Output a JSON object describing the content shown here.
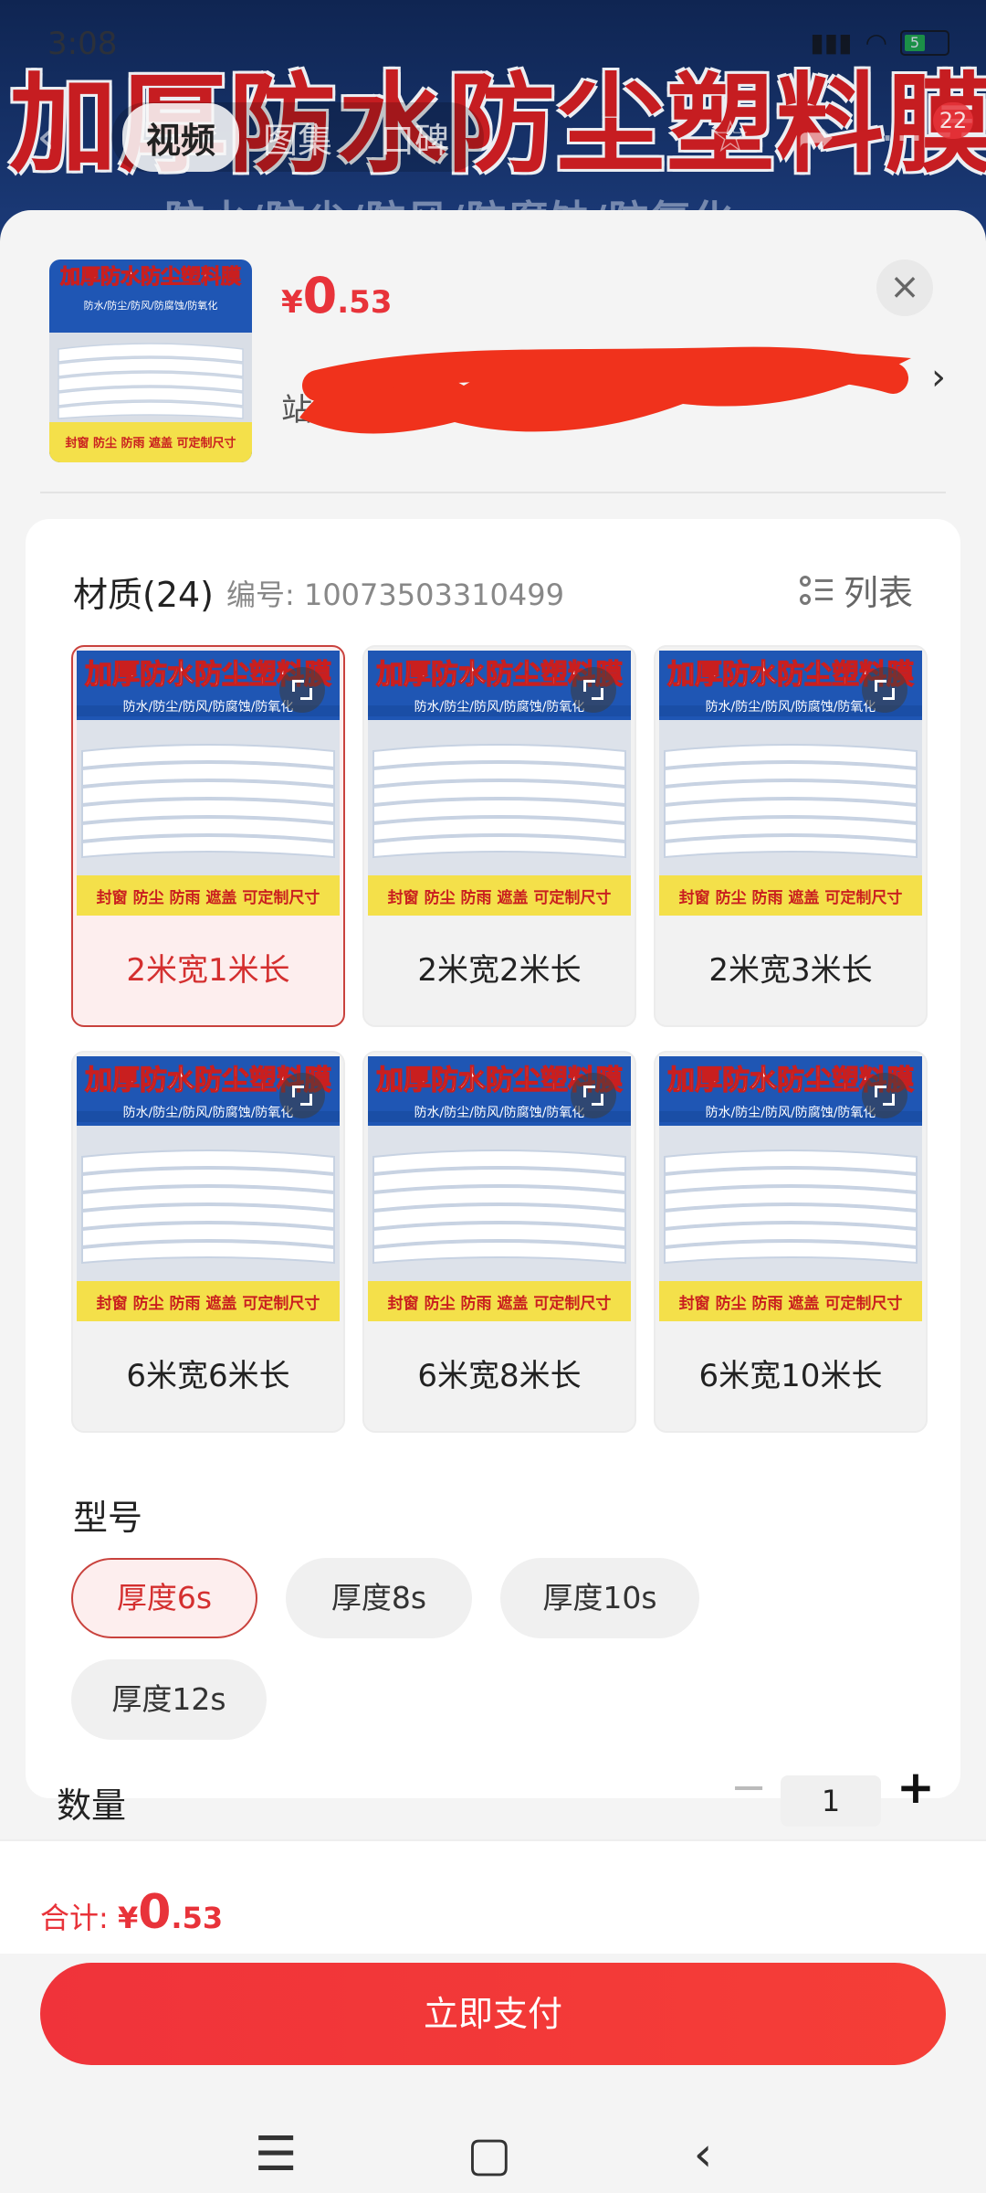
{
  "status_bar": {
    "time": "3:08",
    "battery": "5"
  },
  "banner": {
    "title": "加厚防水防尘塑料膜",
    "subtitle": "防水/防尘/防风/防腐蚀/防氧化"
  },
  "top_nav": {
    "tabs": [
      "视频",
      "图集",
      "口碑"
    ],
    "active_tab": "视频",
    "cart_badge": "22"
  },
  "product": {
    "currency": "¥",
    "price_int": "0",
    "price_dec": ".53",
    "thumb_text": {
      "title": "加厚防水防尘塑料膜",
      "features": "防水/防尘/防风/防腐蚀/防氧化",
      "tags": "封窗 防尘 防雨 遮盖 可定制尺寸"
    },
    "address_partial": "站"
  },
  "material": {
    "title": "材质(24)",
    "code": "编号: 10073503310499",
    "list_label": "列表",
    "options": [
      {
        "label": "2米宽1米长",
        "selected": true
      },
      {
        "label": "2米宽2米长",
        "selected": false
      },
      {
        "label": "2米宽3米长",
        "selected": false
      },
      {
        "label": "6米宽6米长",
        "selected": false
      },
      {
        "label": "6米宽8米长",
        "selected": false
      },
      {
        "label": "6米宽10米长",
        "selected": false
      }
    ]
  },
  "model": {
    "title": "型号",
    "options": [
      {
        "label": "厚度6s",
        "selected": true
      },
      {
        "label": "厚度8s",
        "selected": false
      },
      {
        "label": "厚度10s",
        "selected": false
      },
      {
        "label": "厚度12s",
        "selected": false
      }
    ]
  },
  "quantity": {
    "label": "数量",
    "minus": "−",
    "value": "1",
    "plus": "+"
  },
  "total": {
    "label": "合计: ",
    "currency": "¥",
    "int": "0",
    "dec": ".53"
  },
  "pay_button": "立即支付",
  "colors": {
    "accent": "#e8333a",
    "selected_border": "#c9423d",
    "selected_bg": "#fdeeee"
  }
}
